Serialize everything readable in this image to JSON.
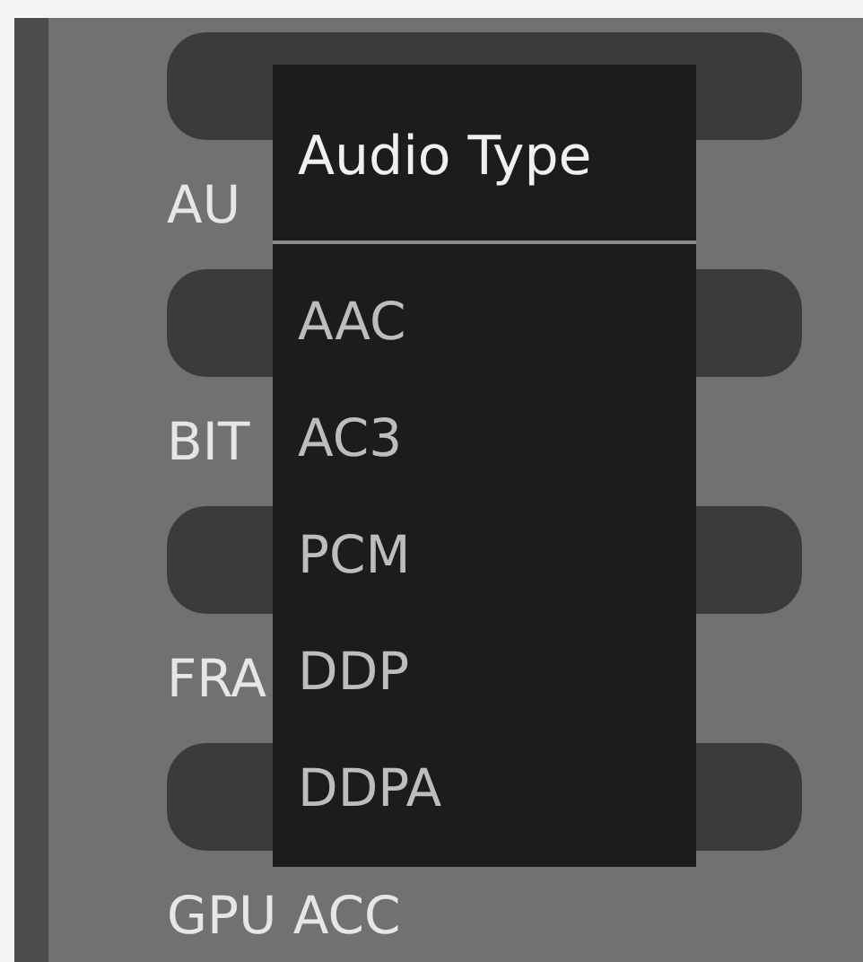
{
  "settings": [
    {
      "label": "AU"
    },
    {
      "label": "BIT"
    },
    {
      "label": "FRA"
    },
    {
      "label": "GPU ACC"
    }
  ],
  "dropdown": {
    "title": "Audio Type",
    "options": [
      {
        "label": "AAC"
      },
      {
        "label": "AC3"
      },
      {
        "label": "PCM"
      },
      {
        "label": "DDP"
      },
      {
        "label": "DDPA"
      }
    ]
  }
}
